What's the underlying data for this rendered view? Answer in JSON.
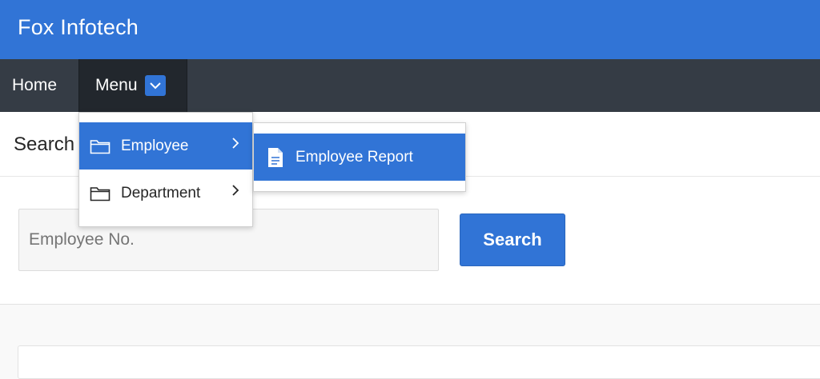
{
  "header": {
    "title": "Fox Infotech"
  },
  "nav": {
    "home_label": "Home",
    "menu_label": "Menu"
  },
  "menu": {
    "items": [
      {
        "label": "Employee",
        "active": true
      },
      {
        "label": "Department",
        "active": false
      }
    ],
    "submenu": {
      "items": [
        {
          "label": "Employee Report",
          "active": true
        }
      ]
    }
  },
  "search_region": {
    "title": "Search",
    "input_placeholder": "Employee No.",
    "input_value": "",
    "button_label": "Search"
  },
  "colors": {
    "brand": "#3174d6",
    "nav_bg": "#353c45",
    "nav_active_bg": "#22272d"
  },
  "icons": {
    "menu_caret": "chevron-down-icon",
    "menu_item": "folder-icon",
    "submenu_arrow": "chevron-right-icon",
    "report": "document-icon"
  }
}
